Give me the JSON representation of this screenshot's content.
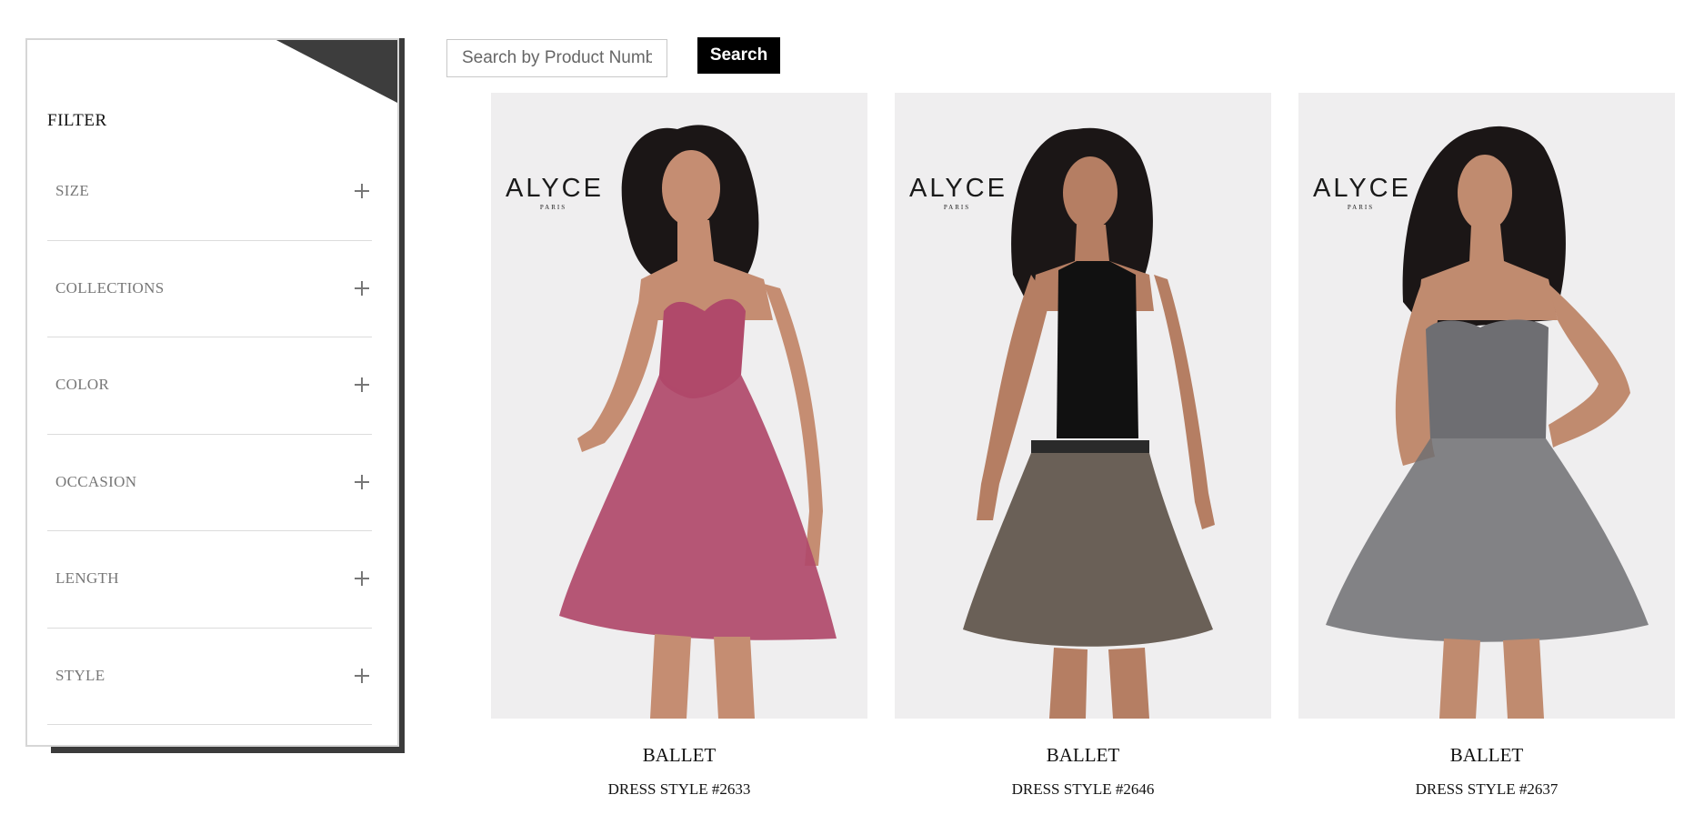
{
  "filter": {
    "title": "FILTER",
    "items": [
      {
        "label": "SIZE"
      },
      {
        "label": "COLLECTIONS"
      },
      {
        "label": "COLOR"
      },
      {
        "label": "OCCASION"
      },
      {
        "label": "LENGTH"
      },
      {
        "label": "STYLE"
      }
    ],
    "expand_icon": "plus-icon"
  },
  "search": {
    "placeholder": "Search by Product Number",
    "value": "",
    "button_label": "Search"
  },
  "brand": {
    "name": "ALYCE",
    "sub": "PARIS"
  },
  "products": [
    {
      "name": "BALLET",
      "style": "DRESS STYLE #2633",
      "dress_color": "#b0496a"
    },
    {
      "name": "BALLET",
      "style": "DRESS STYLE #2646",
      "dress_color": "#111111"
    },
    {
      "name": "BALLET",
      "style": "DRESS STYLE #2637",
      "dress_color": "#6e6e72"
    }
  ],
  "colors": {
    "accent": "#000000",
    "panel_shadow": "#3b3b3b",
    "image_bg": "#efeeef"
  }
}
